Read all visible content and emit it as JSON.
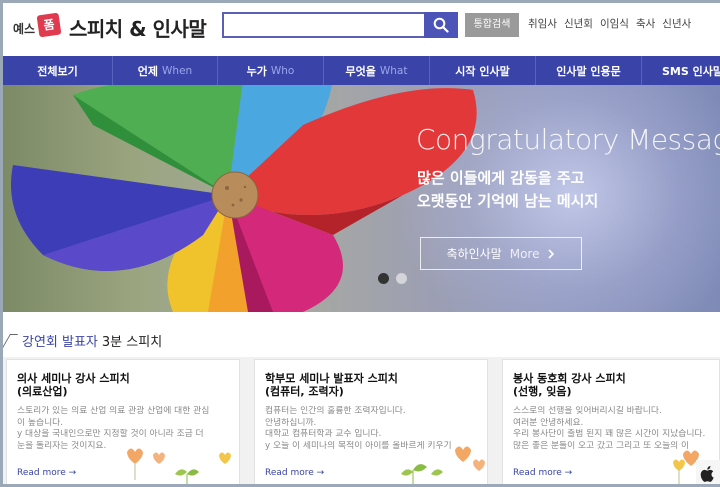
{
  "header": {
    "logo_text": "예스",
    "logo_badge": "폼",
    "site_title": "스피치 & 인사말",
    "search": {
      "value": "",
      "placeholder": ""
    },
    "combined_search_label": "통합검색",
    "quick_links": [
      "취임사",
      "신년회",
      "이임식",
      "축사",
      "신년사"
    ]
  },
  "nav": {
    "items": [
      {
        "label": "전체보기",
        "en": ""
      },
      {
        "label": "언제",
        "en": "When"
      },
      {
        "label": "누가",
        "en": "Who"
      },
      {
        "label": "무엇을",
        "en": "What"
      },
      {
        "label": "시작 인사말",
        "en": ""
      },
      {
        "label": "인사말 인용문",
        "en": ""
      },
      {
        "label": "SMS 인사말",
        "en": ""
      }
    ]
  },
  "banner": {
    "title": "Congratulatory Message",
    "subtitle_line1": "많은 이들에게 감동을 주고",
    "subtitle_line2": "오랫동안 기억에 남는 메시지",
    "button_label": "축하인사말",
    "button_more": "More",
    "slides_total": 2,
    "slides_active": 1
  },
  "section": {
    "title_highlight": "강연회 발표자",
    "title_rest": "3분 스피치"
  },
  "cards": [
    {
      "title_line1": "의사 세미나 강사 스피치",
      "title_line2": "(의료산업)",
      "body": [
        "스토리가 있는 의료 산업 의료 관광 산업에 대한 관심",
        "이 높습니다.",
        "y 대상을 국내인으로만 지정할 것이 아니라 조금 더",
        "눈을 돌리자는 것이지요."
      ],
      "more": "Read more"
    },
    {
      "title_line1": "학부모 세미나 발표자 스피치",
      "title_line2": "(컴퓨터, 조력자)",
      "body": [
        "컴퓨터는 인간의 훌륭한 조력자입니다.",
        "안녕하십니까.",
        "대학교 컴퓨터학과 교수 입니다.",
        "y 오늘 이 세미나의 목적이 아이를 올바르게 키우기"
      ],
      "more": "Read more"
    },
    {
      "title_line1": "봉사 동호회 강사 스피치",
      "title_line2": "(선행, 잊음)",
      "body": [
        "스스로의 선행을 잊어버리시길 바랍니다.",
        "여러분 안녕하세요.",
        "우리 봉사단이 출범 된지 꽤 많은 시간이 지났습니다.",
        "많은 좋은 분들이 오고 갔고 그리고 또 오늘의 이"
      ],
      "more": "Read more"
    }
  ]
}
